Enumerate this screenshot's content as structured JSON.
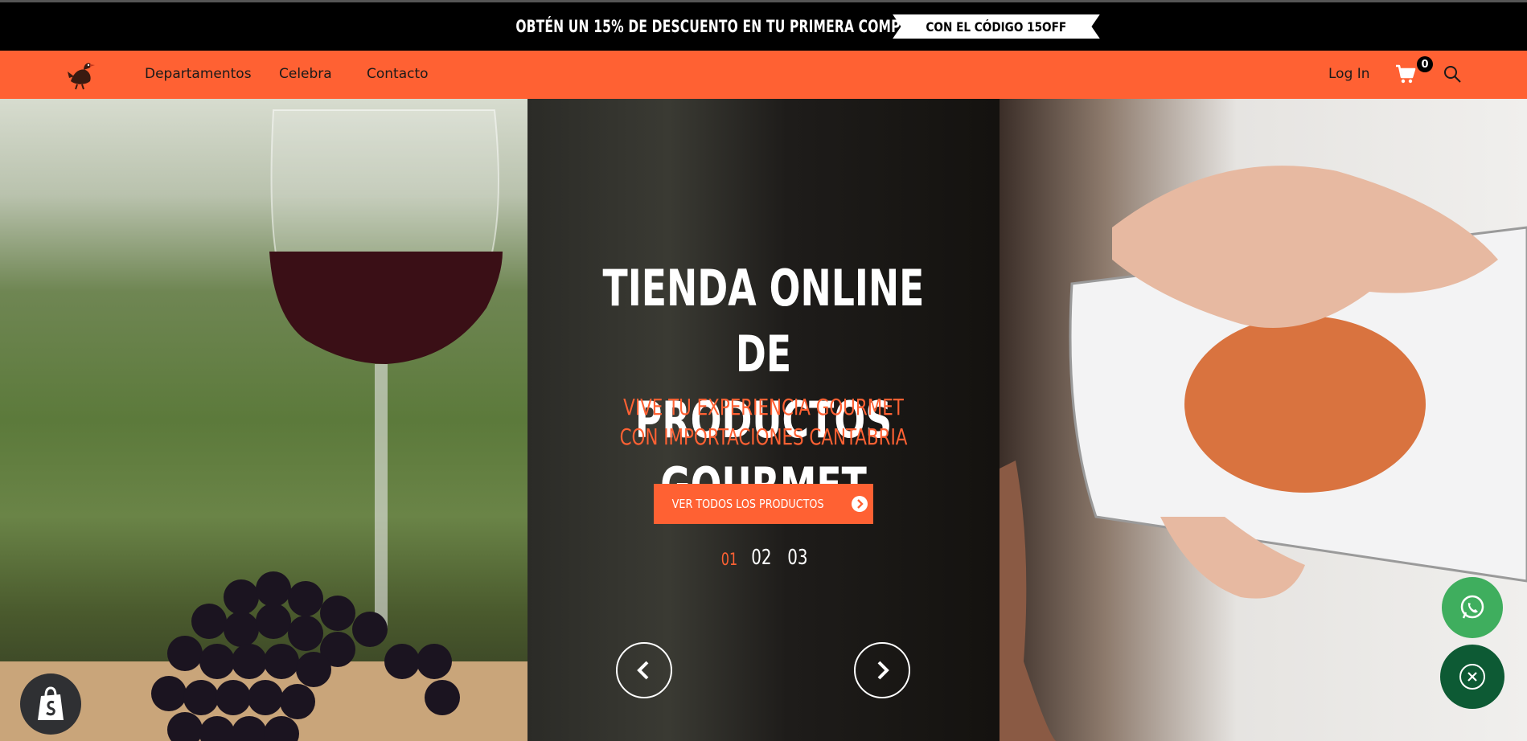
{
  "announcement": {
    "text": "OBTÉN UN 15% DE DESCUENTO EN TU PRIMERA COMPRA",
    "code_label": "CON EL CÓDIGO 15OFF"
  },
  "nav": {
    "links": [
      "Departamentos",
      "Celebra",
      "Contacto"
    ],
    "login_label": "Log In",
    "cart_count": "0"
  },
  "hero": {
    "title_line1": "TIENDA ONLINE DE",
    "title_line2": "PRODUCTOS GOURMET",
    "subtitle_line1": "VIVE TU EXPERIENCIA GOURMET",
    "subtitle_line2": "CON IMPORTACIONES CANTABRIA",
    "cta_label": "VER TODOS LOS PRODUCTOS",
    "slides": [
      "01",
      "02",
      "03"
    ],
    "active_slide": "01"
  },
  "colors": {
    "brand": "#ff6133",
    "announcement_bg": "#000000",
    "whatsapp": "#3fae5e",
    "close_bg": "#0d5a34"
  },
  "icons": [
    "bird-logo-icon",
    "cart-icon",
    "search-icon",
    "arrow-right-circle-icon",
    "chevron-left-icon",
    "chevron-right-icon",
    "shopify-bag-icon",
    "whatsapp-icon",
    "close-icon"
  ]
}
